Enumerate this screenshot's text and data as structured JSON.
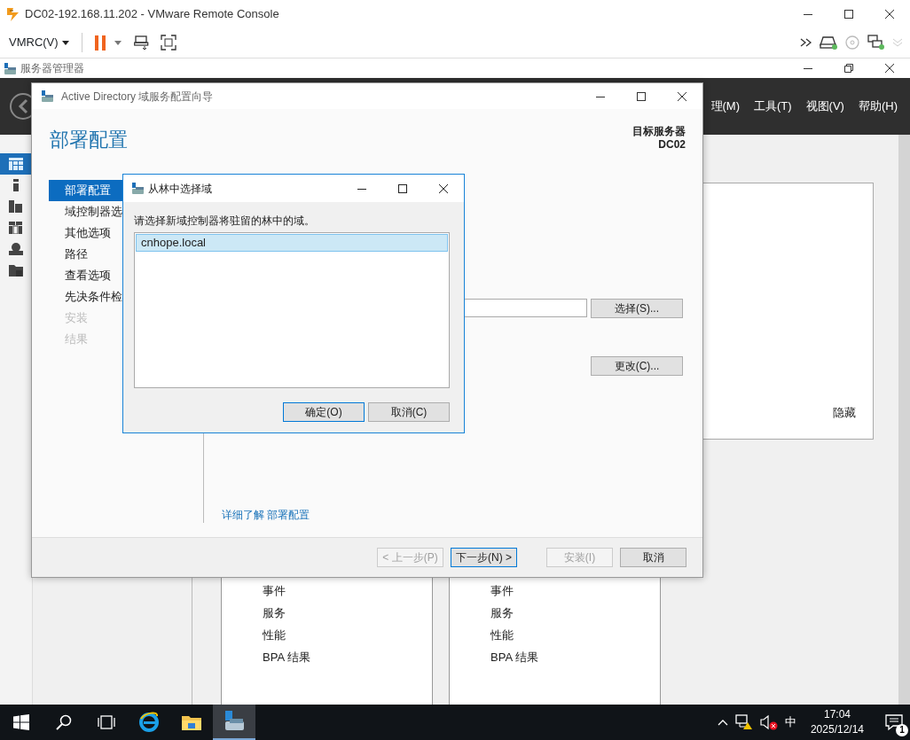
{
  "vmrc": {
    "title": "DC02-192.168.11.202 - VMware Remote Console",
    "menu": "VMRC(V)"
  },
  "server_manager": {
    "title": "服务器管理器",
    "menu": [
      {
        "label": "理(M)"
      },
      {
        "label": "工具(T)"
      },
      {
        "label": "视图(V)"
      },
      {
        "label": "帮助(H)"
      }
    ],
    "nav_icons": [
      {
        "kind": "grid",
        "selected": true
      },
      {
        "kind": "server",
        "selected": false
      },
      {
        "kind": "servers",
        "selected": false
      },
      {
        "kind": "roles",
        "selected": false
      },
      {
        "kind": "globe",
        "selected": false
      },
      {
        "kind": "folder",
        "selected": false
      }
    ],
    "hide": "隐藏",
    "panels": [
      {
        "items": [
          "事件",
          "服务",
          "性能",
          "BPA 结果"
        ]
      },
      {
        "items": [
          "事件",
          "服务",
          "性能",
          "BPA 结果"
        ]
      }
    ]
  },
  "wizard": {
    "title": "Active Directory 域服务配置向导",
    "heading": "部署配置",
    "target_label": "目标服务器",
    "target_name": "DC02",
    "steps": [
      {
        "label": "部署配置",
        "selected": true,
        "disabled": false
      },
      {
        "label": "域控制器选",
        "selected": false,
        "disabled": false
      },
      {
        "label": "其他选项",
        "selected": false,
        "disabled": false
      },
      {
        "label": "路径",
        "selected": false,
        "disabled": false
      },
      {
        "label": "查看选项",
        "selected": false,
        "disabled": false
      },
      {
        "label": "先决条件检",
        "selected": false,
        "disabled": false
      },
      {
        "label": "安装",
        "selected": false,
        "disabled": true
      },
      {
        "label": "结果",
        "selected": false,
        "disabled": true
      }
    ],
    "select_button": "选择(S)...",
    "change_button": "更改(C)...",
    "link": "详细了解 部署配置",
    "buttons": [
      {
        "label": "< 上一步(P)",
        "disabled": true,
        "default": false
      },
      {
        "label": "下一步(N) >",
        "disabled": false,
        "default": true
      },
      {
        "label": "安装(I)",
        "disabled": true,
        "default": false
      },
      {
        "label": "取消",
        "disabled": false,
        "default": false
      }
    ]
  },
  "dialog": {
    "title": "从林中选择域",
    "prompt": "请选择新域控制器将驻留的林中的域。",
    "domains": [
      {
        "label": "cnhope.local",
        "selected": true
      }
    ],
    "buttons": [
      {
        "label": "确定(O)",
        "default": true
      },
      {
        "label": "取消(C)",
        "default": false
      }
    ]
  },
  "taskbar": {
    "apps": [
      {
        "kind": "start",
        "active": false
      },
      {
        "kind": "search",
        "active": false
      },
      {
        "kind": "taskview",
        "active": false
      },
      {
        "kind": "browser",
        "active": false
      },
      {
        "kind": "explorer",
        "active": false
      },
      {
        "kind": "servermanager",
        "active": true
      }
    ],
    "ime": "中",
    "time": "17:04",
    "date": "2025/12/14",
    "notifications": "1"
  }
}
